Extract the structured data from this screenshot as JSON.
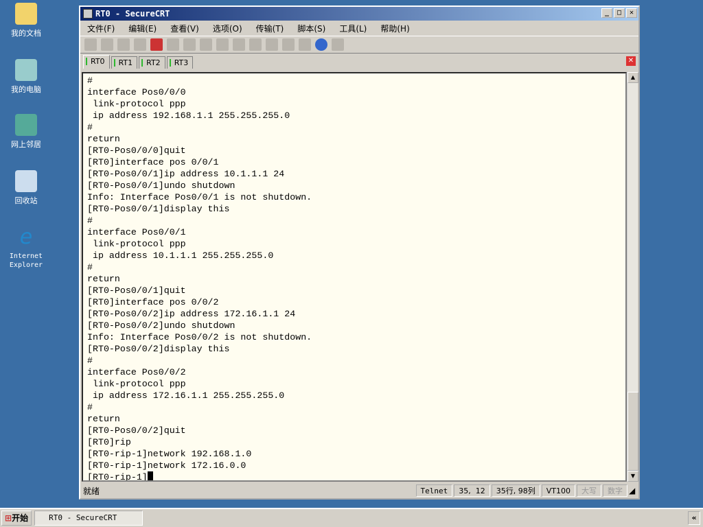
{
  "desktop": [
    "我的文档",
    "我的电脑",
    "网上邻居",
    "回收站",
    "Internet Explorer"
  ],
  "window": {
    "title": "RT0 - SecureCRT"
  },
  "menu": [
    "文件(F)",
    "编辑(E)",
    "查看(V)",
    "选项(O)",
    "传输(T)",
    "脚本(S)",
    "工具(L)",
    "帮助(H)"
  ],
  "tabs": [
    "RT0",
    "RT1",
    "RT2",
    "RT3"
  ],
  "terminal": {
    "lines": [
      "#",
      "interface Pos0/0/0",
      " link-protocol ppp",
      " ip address 192.168.1.1 255.255.255.0",
      "#",
      "return",
      "[RT0-Pos0/0/0]quit",
      "[RT0]interface pos 0/0/1",
      "[RT0-Pos0/0/1]ip address 10.1.1.1 24",
      "[RT0-Pos0/0/1]undo shutdown",
      "Info: Interface Pos0/0/1 is not shutdown.",
      "[RT0-Pos0/0/1]display this",
      "#",
      "interface Pos0/0/1",
      " link-protocol ppp",
      " ip address 10.1.1.1 255.255.255.0",
      "#",
      "return",
      "[RT0-Pos0/0/1]quit",
      "[RT0]interface pos 0/0/2",
      "[RT0-Pos0/0/2]ip address 172.16.1.1 24",
      "[RT0-Pos0/0/2]undo shutdown",
      "Info: Interface Pos0/0/2 is not shutdown.",
      "[RT0-Pos0/0/2]display this",
      "#",
      "interface Pos0/0/2",
      " link-protocol ppp",
      " ip address 172.16.1.1 255.255.255.0",
      "#",
      "return",
      "[RT0-Pos0/0/2]quit",
      "[RT0]rip",
      "[RT0-rip-1]network 192.168.1.0",
      "[RT0-rip-1]network 172.16.0.0",
      "[RT0-rip-1]"
    ]
  },
  "status": {
    "ready": "就绪",
    "protocol": "Telnet",
    "pos": "35,  12",
    "rowcol": "35行, 98列",
    "emulation": "VT100",
    "caps": "大写",
    "num": "数字"
  },
  "taskbar": {
    "start": "开始",
    "task": "RT0 - SecureCRT",
    "tray": "«"
  }
}
